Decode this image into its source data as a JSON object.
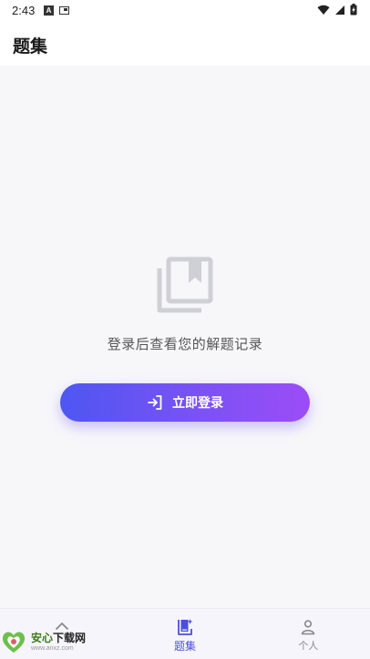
{
  "status_bar": {
    "time": "2:43",
    "notif_letter": "A"
  },
  "header": {
    "title": "题集"
  },
  "empty_state": {
    "icon": "library-bookmark-icon",
    "message": "登录后查看您的解题记录"
  },
  "login": {
    "label": "立即登录",
    "icon": "login-arrow-icon"
  },
  "bottom_nav": {
    "items": [
      {
        "label": "",
        "icon": "chevron-up-icon"
      },
      {
        "label": "题集",
        "icon": "book-sparkle-icon",
        "active": true
      },
      {
        "label": "个人",
        "icon": "person-icon"
      }
    ]
  },
  "watermark": {
    "title_green": "安心",
    "title_dark": "下载网",
    "url": "www.anxz.com"
  },
  "colors": {
    "accent": "#4b4fdc",
    "gradient_start": "#4e56f2",
    "gradient_end": "#9c4cf7",
    "background": "#f7f7fa"
  }
}
